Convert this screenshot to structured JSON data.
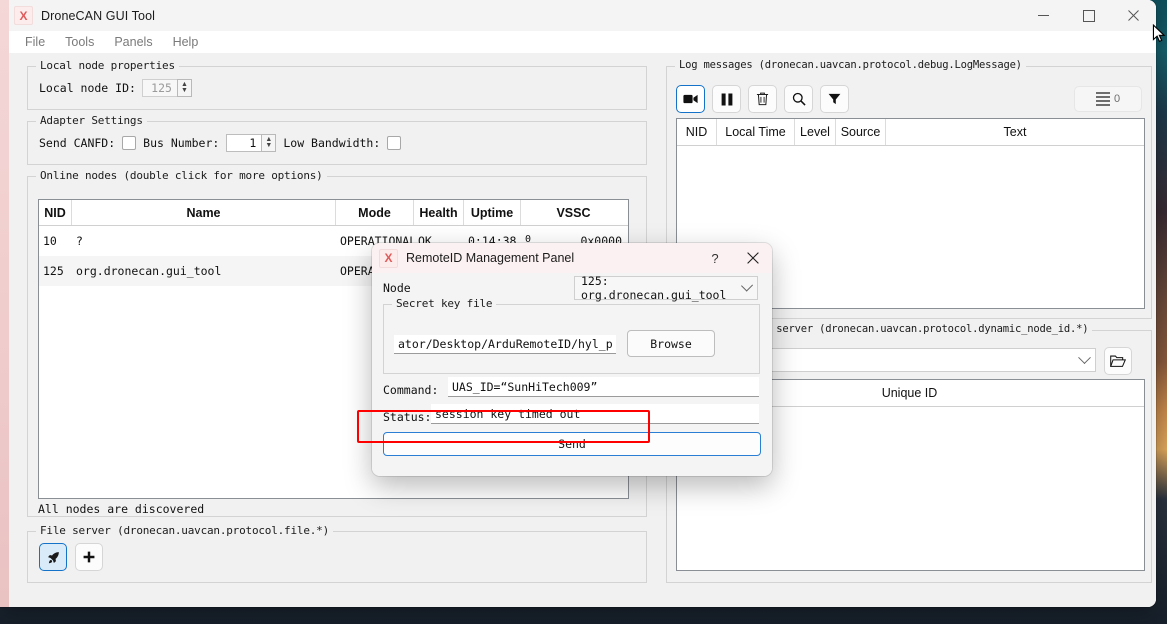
{
  "window": {
    "title": "DroneCAN GUI Tool",
    "app_icon": "dronecan-x-icon",
    "controls": {
      "minimize": "minimize-icon",
      "maximize": "maximize-icon",
      "close": "close-icon"
    }
  },
  "menubar": {
    "items": [
      "File",
      "Tools",
      "Panels",
      "Help"
    ]
  },
  "left": {
    "local_node_properties": {
      "title": "Local node properties",
      "node_id_label": "Local node ID:",
      "node_id_value": "125"
    },
    "adapter_settings": {
      "title": "Adapter Settings",
      "send_canfd_label": "Send CANFD:",
      "bus_number_label": "Bus Number:",
      "bus_number_value": "1",
      "low_bandwidth_label": "Low Bandwidth:"
    },
    "online_nodes": {
      "title": "Online nodes (double click for more options)",
      "columns": [
        "NID",
        "Name",
        "Mode",
        "Health",
        "Uptime",
        "VSSC"
      ],
      "rows": [
        {
          "nid": "10",
          "name": "?",
          "mode": "OPERATIONAL",
          "health": "OK",
          "uptime": "0:14:38",
          "vssc_a": "0",
          "vssc": "0x0000"
        },
        {
          "nid": "125",
          "name": "org.dronecan.gui_tool",
          "mode": "OPERATI",
          "health": "",
          "uptime": "",
          "vssc_a": "",
          "vssc": ""
        }
      ],
      "status": "All nodes are discovered"
    },
    "file_server": {
      "title": "File server (dronecan.uavcan.protocol.file.*)",
      "buttons": [
        "rocket-icon",
        "plus-icon"
      ]
    }
  },
  "right": {
    "log_messages": {
      "title": "Log messages (dronecan.uavcan.protocol.debug.LogMessage)",
      "toolbar": [
        "record-icon",
        "pause-icon",
        "trash-icon",
        "search-icon",
        "filter-icon"
      ],
      "count_badge": "0",
      "columns": [
        "NID",
        "Local Time",
        "Level",
        "Source",
        "Text"
      ],
      "rows": []
    },
    "allocation_server": {
      "title": "llocation server (dronecan.uavcan.protocol.dynamic_node_id.*)",
      "combo_value": "",
      "folder_button": "folder-open-icon",
      "columns": [
        "Unique ID"
      ],
      "rows": []
    }
  },
  "dialog": {
    "title": "RemoteID Management Panel",
    "app_icon": "dronecan-x-icon",
    "help_label": "?",
    "close_label": "✕",
    "node_label": "Node",
    "node_value": "125: org.dronecan.gui_tool",
    "secret_key_group": "Secret key file",
    "secret_key_path": "ator/Desktop/ArduRemoteID/hyl_private_key.dat",
    "browse_label": "Browse",
    "command_label": "Command:",
    "command_value": "UAS_ID=“SunHiTech009”",
    "status_label": "Status:",
    "status_value": "session key timed out",
    "send_label": "Send"
  },
  "annotation": {
    "highlight_color": "#ff0000",
    "target": "status-field"
  },
  "colors": {
    "accent": "#1473c8",
    "title_pink": "#fcf1f2",
    "window_bg": "#f1f1f1"
  }
}
